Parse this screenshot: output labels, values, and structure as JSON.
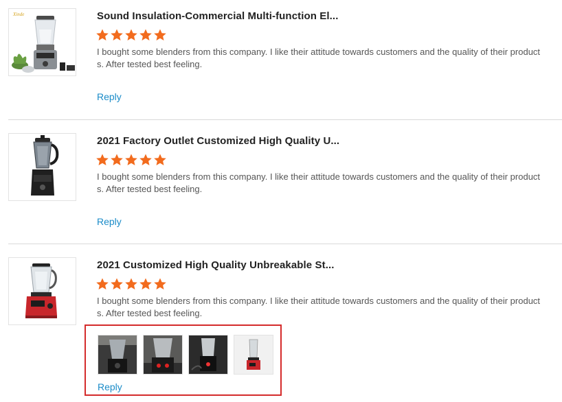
{
  "reviews": [
    {
      "title": "Sound Insulation-Commercial Multi-function El...",
      "rating": 5,
      "text": "I bought some blenders from this company. I like their attitude towards customers and the quality of their products. After tested best feeling.",
      "reply_label": "Reply",
      "thumb_logo": "Xinde"
    },
    {
      "title": "2021 Factory Outlet Customized High Quality U...",
      "rating": 5,
      "text": "I bought some blenders from this company. I like their attitude towards customers and the quality of their products. After tested best feeling.",
      "reply_label": "Reply"
    },
    {
      "title": "2021 Customized High Quality Unbreakable St...",
      "rating": 5,
      "text": "I bought some blenders from this company. I like their attitude towards customers and the quality of their products. After tested best feeling.",
      "reply_label": "Reply",
      "photo_count": 4
    }
  ],
  "colors": {
    "star": "#f26b1d",
    "reply_link": "#1a8bc8",
    "highlight_border": "#d42a2a"
  },
  "icons": {
    "rating": "star-icon"
  }
}
